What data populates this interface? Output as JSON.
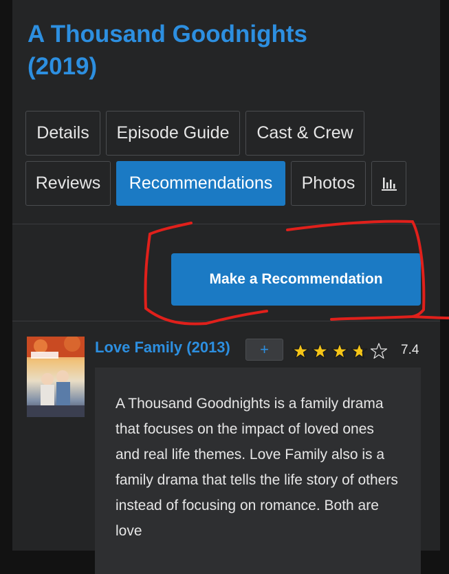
{
  "page": {
    "title": "A Thousand Goodnights (2019)"
  },
  "tabs": [
    {
      "label": "Details",
      "active": false
    },
    {
      "label": "Episode Guide",
      "active": false
    },
    {
      "label": "Cast & Crew",
      "active": false
    },
    {
      "label": "Reviews",
      "active": false
    },
    {
      "label": "Recommendations",
      "active": true
    },
    {
      "label": "Photos",
      "active": false
    },
    {
      "label": "",
      "icon": "bar-chart-icon",
      "active": false
    }
  ],
  "actions": {
    "make_recommendation_label": "Make a Recommendation"
  },
  "recommendation": {
    "title": "Love Family (2013)",
    "add_label": "+",
    "rating": "7.4",
    "stars_filled_fraction": 0.74,
    "review": "A Thousand Goodnights is a family drama that focuses on the impact of loved ones and real life themes. Love Family also is a family drama that tells the life story of others instead of focusing on romance. Both are love"
  },
  "colors": {
    "accent": "#2d8fe0",
    "button": "#1b7ac4",
    "background": "#242526",
    "star": "#f5c518",
    "annotation": "#e0201b"
  }
}
